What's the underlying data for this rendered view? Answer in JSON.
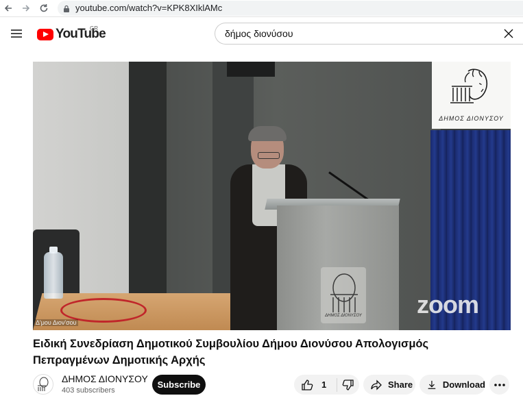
{
  "browser": {
    "url": "youtube.com/watch?v=KPK8XIklAMc",
    "icons": [
      "back-icon",
      "forward-icon",
      "reload-icon",
      "lock-icon"
    ]
  },
  "header": {
    "logo_text": "YouTube",
    "country_code": "GR",
    "search_value": "δήμος διονύσου",
    "icons": [
      "menu-icon",
      "clear-icon"
    ]
  },
  "video": {
    "logo_card_text": "ΔΗΜΟΣ ΔΙΟΝΥΣΟΥ",
    "zoom_watermark": "zoom",
    "corner_watermark": "Δ'μου Διον'σου",
    "podium_text": "ΔΗΜΟΣ ΔΙΟΝΥΣΟΥ"
  },
  "title": "Ειδική Συνεδρίαση Δημοτικού Συμβουλίου Δήμου Διονύσου Απολογισμός Πεπραγμένων Δημοτικής Αρχής",
  "channel": {
    "name": "ΔΗΜΟΣ ΔΙΟΝΥΣΟΥ",
    "subscribers": "403 subscribers",
    "subscribe_label": "Subscribe"
  },
  "actions": {
    "like_count": "1",
    "share_label": "Share",
    "download_label": "Download"
  },
  "colors": {
    "brand_red": "#ff0000",
    "button_dark": "#0f0f0f",
    "pill_bg": "#f2f2f2"
  }
}
